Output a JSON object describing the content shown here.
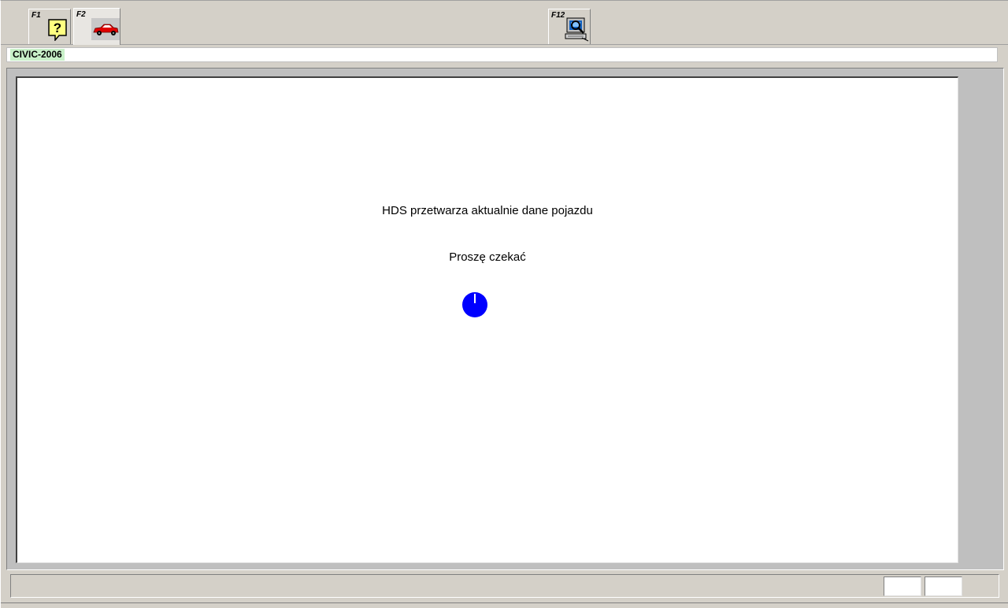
{
  "toolbar": {
    "buttons": [
      {
        "key": "F1",
        "icon": "help-icon"
      },
      {
        "key": "F2",
        "icon": "car-icon"
      },
      {
        "key": "F12",
        "icon": "computer-search-icon"
      }
    ]
  },
  "vehicle": {
    "model": "CIVIC-2006"
  },
  "main": {
    "message": "HDS przetwarza aktualnie dane pojazdu",
    "wait_text": "Proszę czekać",
    "spinner_icon": "loading-spinner-icon",
    "spinner_color": "#0000ff"
  },
  "status_bar": {
    "cells": [
      "",
      ""
    ]
  },
  "colors": {
    "chrome": "#d4d0c8",
    "vehicle_highlight": "#c8f0c8",
    "panel_background": "#ffffff"
  }
}
